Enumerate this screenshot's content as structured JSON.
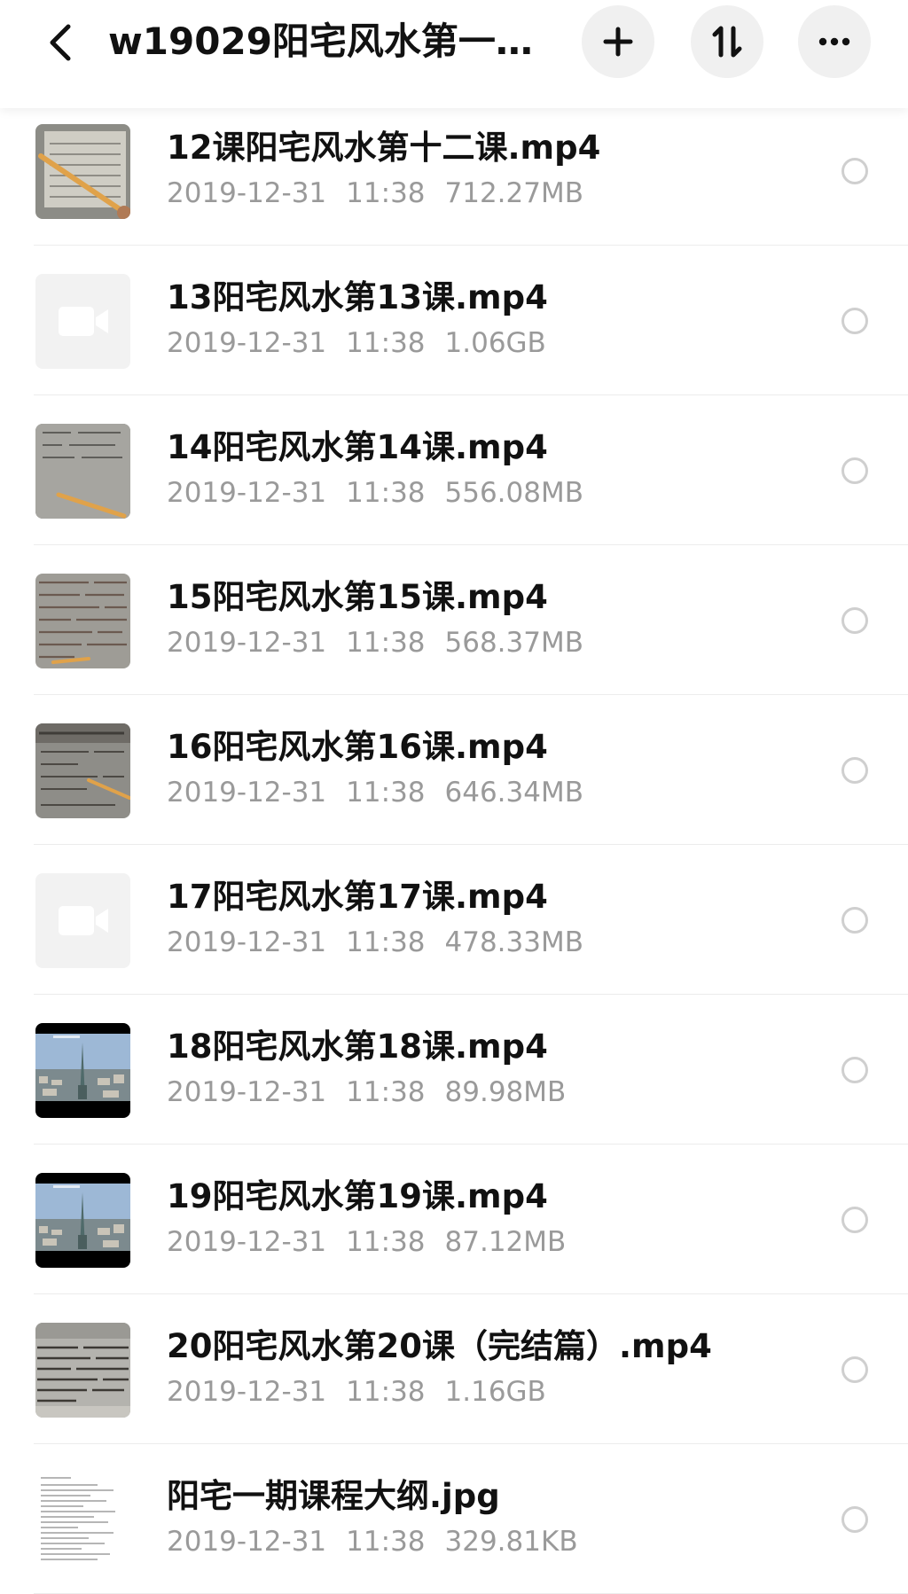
{
  "header": {
    "title": "w19029阳宅风水第一...",
    "back_icon": "chevron-left-icon",
    "add_icon": "plus-icon",
    "sort_icon": "sort-icon",
    "more_icon": "more-horizontal-icon"
  },
  "files": [
    {
      "name": "12课阳宅风水第十二课.mp4",
      "date": "2019-12-31",
      "time": "11:38",
      "size": "712.27MB",
      "thumb": "video-frame-paper"
    },
    {
      "name": "13阳宅风水第13课.mp4",
      "date": "2019-12-31",
      "time": "11:38",
      "size": "1.06GB",
      "thumb": "video-placeholder-icon"
    },
    {
      "name": "14阳宅风水第14课.mp4",
      "date": "2019-12-31",
      "time": "11:38",
      "size": "556.08MB",
      "thumb": "video-frame-paper"
    },
    {
      "name": "15阳宅风水第15课.mp4",
      "date": "2019-12-31",
      "time": "11:38",
      "size": "568.37MB",
      "thumb": "video-frame-text"
    },
    {
      "name": "16阳宅风水第16课.mp4",
      "date": "2019-12-31",
      "time": "11:38",
      "size": "646.34MB",
      "thumb": "video-frame-text"
    },
    {
      "name": "17阳宅风水第17课.mp4",
      "date": "2019-12-31",
      "time": "11:38",
      "size": "478.33MB",
      "thumb": "video-placeholder-icon"
    },
    {
      "name": "18阳宅风水第18课.mp4",
      "date": "2019-12-31",
      "time": "11:38",
      "size": "89.98MB",
      "thumb": "video-frame-city"
    },
    {
      "name": "19阳宅风水第19课.mp4",
      "date": "2019-12-31",
      "time": "11:38",
      "size": "87.12MB",
      "thumb": "video-frame-city"
    },
    {
      "name": "20阳宅风水第20课（完结篇）.mp4",
      "date": "2019-12-31",
      "time": "11:38",
      "size": "1.16GB",
      "thumb": "video-frame-text"
    },
    {
      "name": "阳宅一期课程大纲.jpg",
      "date": "2019-12-31",
      "time": "11:38",
      "size": "329.81KB",
      "thumb": "image-document"
    }
  ],
  "colors": {
    "meta_text": "#9a9a9a",
    "button_bg": "#f0f0f0",
    "divider": "#ececec",
    "radio_border": "#cfcfcf"
  }
}
